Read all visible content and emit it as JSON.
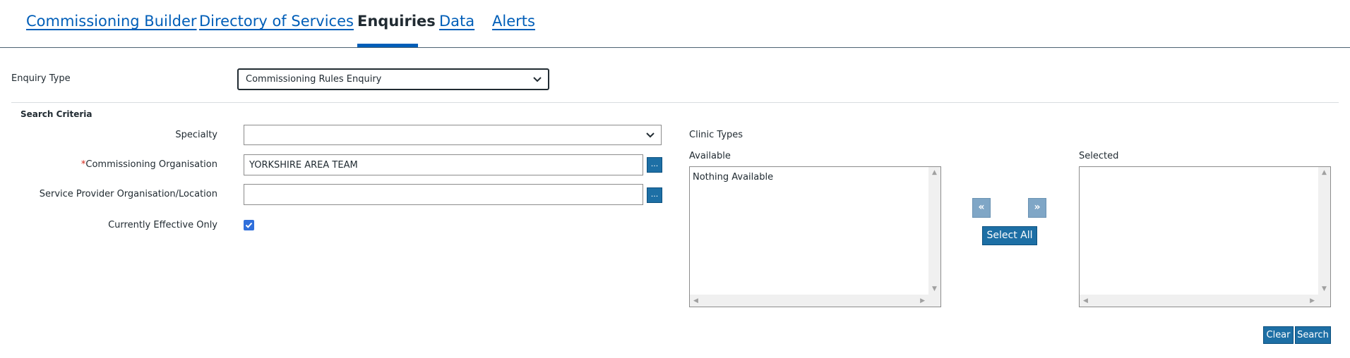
{
  "nav": {
    "tabs": [
      {
        "label": "Commissioning Builder"
      },
      {
        "label": "Directory of Services"
      },
      {
        "label": "Enquiries"
      },
      {
        "label": "Data"
      },
      {
        "label": "Alerts"
      }
    ],
    "active_tab": "Enquiries"
  },
  "enquiry": {
    "type_label": "Enquiry Type",
    "type_value": "Commissioning Rules Enquiry"
  },
  "search_criteria": {
    "heading": "Search Criteria",
    "specialty_label": "Specialty",
    "specialty_value": "",
    "required_marker": "*",
    "commissioning_org_label": "Commissioning Organisation",
    "commissioning_org_value": "YORKSHIRE AREA TEAM",
    "service_provider_label": "Service Provider Organisation/Location",
    "service_provider_value": "",
    "lookup_button_label": "...",
    "currently_effective_label": "Currently Effective Only",
    "currently_effective_checked": true
  },
  "clinic_types": {
    "heading": "Clinic Types",
    "available_label": "Available",
    "available_items": [
      "Nothing Available"
    ],
    "selected_label": "Selected",
    "selected_items": [],
    "move_left_label": "«",
    "move_right_label": "»",
    "select_all_label": "Select All"
  },
  "actions": {
    "clear_label": "Clear",
    "search_label": "Search"
  },
  "colors": {
    "link": "#005eb8",
    "button": "#1d6fa5",
    "button_disabled": "#7fa6c6",
    "required": "#d5281b",
    "checkbox": "#2f6fdb"
  }
}
